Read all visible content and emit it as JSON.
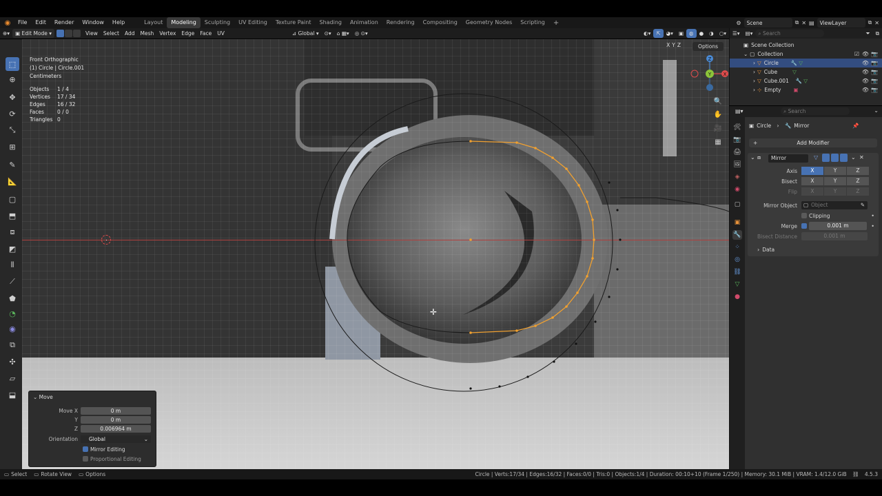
{
  "topbar": {
    "menu": [
      "File",
      "Edit",
      "Render",
      "Window",
      "Help"
    ],
    "workspaces": [
      "Layout",
      "Modeling",
      "Sculpting",
      "UV Editing",
      "Texture Paint",
      "Shading",
      "Animation",
      "Rendering",
      "Compositing",
      "Geometry Nodes",
      "Scripting"
    ],
    "active_workspace": "Modeling",
    "scene": "Scene",
    "view_layer": "ViewLayer"
  },
  "viewport_header": {
    "mode": "Edit Mode",
    "menus": [
      "View",
      "Select",
      "Add",
      "Mesh",
      "Vertex",
      "Edge",
      "Face",
      "UV"
    ],
    "orientation": "Global",
    "options": "Options",
    "axes": [
      "X",
      "Y",
      "Z"
    ]
  },
  "viewport": {
    "view_name": "Front Orthographic",
    "object_line": "(1) Circle | Circle.001",
    "units": "Centimeters",
    "stats": [
      {
        "k": "Objects",
        "v": "1 / 4"
      },
      {
        "k": "Vertices",
        "v": "17 / 34"
      },
      {
        "k": "Edges",
        "v": "16 / 32"
      },
      {
        "k": "Faces",
        "v": "0 / 0"
      },
      {
        "k": "Triangles",
        "v": "0"
      }
    ],
    "gizmo_axis_labels": [
      "X",
      "Y",
      "Z"
    ]
  },
  "operator_panel": {
    "title": "Move",
    "move_x_label": "Move X",
    "move_x": "0 m",
    "y_label": "Y",
    "y": "0 m",
    "z_label": "Z",
    "z": "0.006964 m",
    "orientation_label": "Orientation",
    "orientation": "Global",
    "mirror_editing": "Mirror Editing",
    "proportional_editing": "Proportional Editing"
  },
  "statusbar": {
    "select": "Select",
    "rotate": "Rotate View",
    "options": "Options",
    "info": "Circle | Verts:17/34 | Edges:16/32 | Faces:0/0 | Tris:0 | Objects:1/4 | Duration: 00:10+10 (Frame 1/250) | Memory: 30.1 MiB | VRAM: 1.4/12.0 GiB",
    "version": "4.5.3"
  },
  "outliner": {
    "search_placeholder": "Search",
    "root": "Scene Collection",
    "collection": "Collection",
    "items": [
      "Circle",
      "Cube",
      "Cube.001",
      "Empty"
    ]
  },
  "properties": {
    "search_placeholder": "Search",
    "object": "Circle",
    "modifier_crumb": "Mirror",
    "add_modifier": "Add Modifier",
    "modifier_name": "Mirror",
    "axis_label": "Axis",
    "bisect_label": "Bisect",
    "flip_label": "Flip",
    "mirror_object_label": "Mirror Object",
    "mirror_object_placeholder": "Object",
    "clipping_label": "Clipping",
    "merge_label": "Merge",
    "merge_value": "0.001 m",
    "bisect_distance_label": "Bisect Distance",
    "bisect_distance_value": "0.001 m",
    "data_label": "Data"
  },
  "colors": {
    "accent": "#4772b3",
    "selected_edge": "#f0a030",
    "x_axis": "#e04c4c"
  }
}
